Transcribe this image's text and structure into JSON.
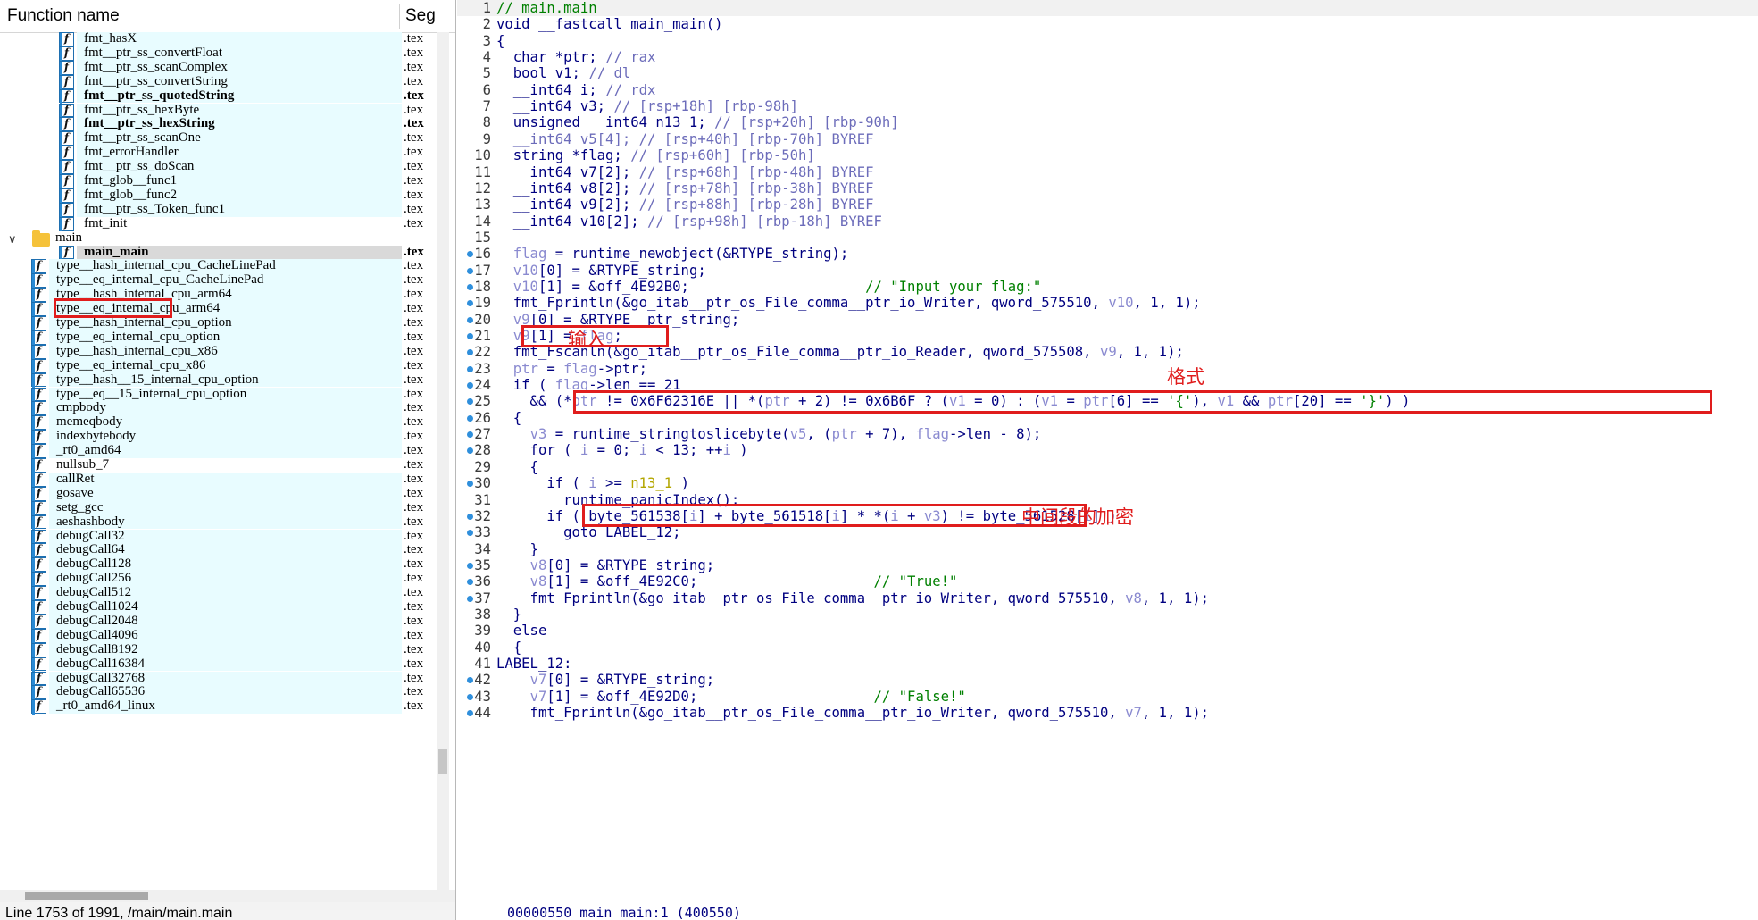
{
  "function_panel": {
    "header_name": "Function name",
    "header_seg": "Seg",
    "status": "Line 1753 of 1991, /main/main.main",
    "rows": [
      {
        "name": "fmt_hasX",
        "seg": ".tex",
        "indent": 2,
        "bold": false,
        "bg": "cyan"
      },
      {
        "name": "fmt__ptr_ss_convertFloat",
        "seg": ".tex",
        "indent": 2,
        "bold": false,
        "bg": "cyan"
      },
      {
        "name": "fmt__ptr_ss_scanComplex",
        "seg": ".tex",
        "indent": 2,
        "bold": false,
        "bg": "cyan"
      },
      {
        "name": "fmt__ptr_ss_convertString",
        "seg": ".tex",
        "indent": 2,
        "bold": false,
        "bg": "cyan"
      },
      {
        "name": "fmt__ptr_ss_quotedString",
        "seg": ".tex",
        "indent": 2,
        "bold": true,
        "bg": "cyan"
      },
      {
        "name": "fmt__ptr_ss_hexByte",
        "seg": ".tex",
        "indent": 2,
        "bold": false,
        "bg": "cyan"
      },
      {
        "name": "fmt__ptr_ss_hexString",
        "seg": ".tex",
        "indent": 2,
        "bold": true,
        "bg": "cyan"
      },
      {
        "name": "fmt__ptr_ss_scanOne",
        "seg": ".tex",
        "indent": 2,
        "bold": false,
        "bg": "cyan"
      },
      {
        "name": "fmt_errorHandler",
        "seg": ".tex",
        "indent": 2,
        "bold": false,
        "bg": "cyan"
      },
      {
        "name": "fmt__ptr_ss_doScan",
        "seg": ".tex",
        "indent": 2,
        "bold": false,
        "bg": "cyan"
      },
      {
        "name": "fmt_glob__func1",
        "seg": ".tex",
        "indent": 2,
        "bold": false,
        "bg": "cyan"
      },
      {
        "name": "fmt_glob__func2",
        "seg": ".tex",
        "indent": 2,
        "bold": false,
        "bg": "cyan"
      },
      {
        "name": "fmt__ptr_ss_Token_func1",
        "seg": ".tex",
        "indent": 2,
        "bold": false,
        "bg": "cyan"
      },
      {
        "name": "fmt_init",
        "seg": ".tex",
        "indent": 2,
        "bold": false,
        "bg": "white"
      },
      {
        "name": "main",
        "seg": "",
        "indent": 0,
        "bold": false,
        "bg": "white",
        "folder": true
      },
      {
        "name": "main_main",
        "seg": ".tex",
        "indent": 2,
        "bold": true,
        "bg": "gray"
      },
      {
        "name": "type__hash_internal_cpu_CacheLinePad",
        "seg": ".tex",
        "indent": 1,
        "bold": false,
        "bg": "cyan"
      },
      {
        "name": "type__eq_internal_cpu_CacheLinePad",
        "seg": ".tex",
        "indent": 1,
        "bold": false,
        "bg": "cyan"
      },
      {
        "name": "type__hash_internal_cpu_arm64",
        "seg": ".tex",
        "indent": 1,
        "bold": false,
        "bg": "cyan"
      },
      {
        "name": "type__eq_internal_cpu_arm64",
        "seg": ".tex",
        "indent": 1,
        "bold": false,
        "bg": "cyan"
      },
      {
        "name": "type__hash_internal_cpu_option",
        "seg": ".tex",
        "indent": 1,
        "bold": false,
        "bg": "cyan"
      },
      {
        "name": "type__eq_internal_cpu_option",
        "seg": ".tex",
        "indent": 1,
        "bold": false,
        "bg": "cyan"
      },
      {
        "name": "type__hash_internal_cpu_x86",
        "seg": ".tex",
        "indent": 1,
        "bold": false,
        "bg": "cyan"
      },
      {
        "name": "type__eq_internal_cpu_x86",
        "seg": ".tex",
        "indent": 1,
        "bold": false,
        "bg": "cyan"
      },
      {
        "name": "type__hash__15_internal_cpu_option",
        "seg": ".tex",
        "indent": 1,
        "bold": false,
        "bg": "cyan"
      },
      {
        "name": "type__eq__15_internal_cpu_option",
        "seg": ".tex",
        "indent": 1,
        "bold": false,
        "bg": "cyan"
      },
      {
        "name": "cmpbody",
        "seg": ".tex",
        "indent": 1,
        "bold": false,
        "bg": "cyan"
      },
      {
        "name": "memeqbody",
        "seg": ".tex",
        "indent": 1,
        "bold": false,
        "bg": "cyan"
      },
      {
        "name": "indexbytebody",
        "seg": ".tex",
        "indent": 1,
        "bold": false,
        "bg": "cyan"
      },
      {
        "name": "_rt0_amd64",
        "seg": ".tex",
        "indent": 1,
        "bold": false,
        "bg": "cyan"
      },
      {
        "name": "nullsub_7",
        "seg": ".tex",
        "indent": 1,
        "bold": false,
        "bg": "white"
      },
      {
        "name": "callRet",
        "seg": ".tex",
        "indent": 1,
        "bold": false,
        "bg": "cyan"
      },
      {
        "name": "gosave",
        "seg": ".tex",
        "indent": 1,
        "bold": false,
        "bg": "cyan"
      },
      {
        "name": "setg_gcc",
        "seg": ".tex",
        "indent": 1,
        "bold": false,
        "bg": "cyan"
      },
      {
        "name": "aeshashbody",
        "seg": ".tex",
        "indent": 1,
        "bold": false,
        "bg": "cyan"
      },
      {
        "name": "debugCall32",
        "seg": ".tex",
        "indent": 1,
        "bold": false,
        "bg": "cyan"
      },
      {
        "name": "debugCall64",
        "seg": ".tex",
        "indent": 1,
        "bold": false,
        "bg": "cyan"
      },
      {
        "name": "debugCall128",
        "seg": ".tex",
        "indent": 1,
        "bold": false,
        "bg": "cyan"
      },
      {
        "name": "debugCall256",
        "seg": ".tex",
        "indent": 1,
        "bold": false,
        "bg": "cyan"
      },
      {
        "name": "debugCall512",
        "seg": ".tex",
        "indent": 1,
        "bold": false,
        "bg": "cyan"
      },
      {
        "name": "debugCall1024",
        "seg": ".tex",
        "indent": 1,
        "bold": false,
        "bg": "cyan"
      },
      {
        "name": "debugCall2048",
        "seg": ".tex",
        "indent": 1,
        "bold": false,
        "bg": "cyan"
      },
      {
        "name": "debugCall4096",
        "seg": ".tex",
        "indent": 1,
        "bold": false,
        "bg": "cyan"
      },
      {
        "name": "debugCall8192",
        "seg": ".tex",
        "indent": 1,
        "bold": false,
        "bg": "cyan"
      },
      {
        "name": "debugCall16384",
        "seg": ".tex",
        "indent": 1,
        "bold": false,
        "bg": "cyan"
      },
      {
        "name": "debugCall32768",
        "seg": ".tex",
        "indent": 1,
        "bold": false,
        "bg": "cyan"
      },
      {
        "name": "debugCall65536",
        "seg": ".tex",
        "indent": 1,
        "bold": false,
        "bg": "cyan"
      },
      {
        "name": "_rt0_amd64_linux",
        "seg": ".tex",
        "indent": 1,
        "bold": false,
        "bg": "cyan"
      }
    ]
  },
  "code_panel": {
    "lines": [
      {
        "n": "1",
        "dot": false,
        "html": "<span class='tok-g'>// main.main</span>"
      },
      {
        "n": "2",
        "dot": false,
        "html": "void __fastcall main_main()"
      },
      {
        "n": "3",
        "dot": false,
        "html": "{"
      },
      {
        "n": "4",
        "dot": false,
        "html": "  char *ptr; <span class='tok-c'>// rax</span>"
      },
      {
        "n": "5",
        "dot": false,
        "html": "  bool v1; <span class='tok-c'>// dl</span>"
      },
      {
        "n": "6",
        "dot": false,
        "html": "  __int64 i; <span class='tok-c'>// rdx</span>"
      },
      {
        "n": "7",
        "dot": false,
        "html": "  __int64 v3; <span class='tok-c'>// [rsp+18h] [rbp-98h]</span>"
      },
      {
        "n": "8",
        "dot": false,
        "html": "  unsigned __int64 n13_1; <span class='tok-c'>// [rsp+20h] [rbp-90h]</span>"
      },
      {
        "n": "9",
        "dot": false,
        "html": "  <span class='tok-c'>__int64 v5[4]; // [rsp+40h] [rbp-70h] BYREF</span>"
      },
      {
        "n": "10",
        "dot": false,
        "html": "  string *flag; <span class='tok-c'>// [rsp+60h] [rbp-50h]</span>"
      },
      {
        "n": "11",
        "dot": false,
        "html": "  __int64 v7[2]; <span class='tok-c'>// [rsp+68h] [rbp-48h] BYREF</span>"
      },
      {
        "n": "12",
        "dot": false,
        "html": "  __int64 v8[2]; <span class='tok-c'>// [rsp+78h] [rbp-38h] BYREF</span>"
      },
      {
        "n": "13",
        "dot": false,
        "html": "  __int64 v9[2]; <span class='tok-c'>// [rsp+88h] [rbp-28h] BYREF</span>"
      },
      {
        "n": "14",
        "dot": false,
        "html": "  __int64 v10[2]; <span class='tok-c'>// [rsp+98h] [rbp-18h] BYREF</span>"
      },
      {
        "n": "15",
        "dot": false,
        "html": ""
      },
      {
        "n": "16",
        "dot": true,
        "html": "  <span class='tok-v'>flag</span> = runtime_newobject(&amp;RTYPE_string);"
      },
      {
        "n": "17",
        "dot": true,
        "html": "  <span class='tok-v'>v10</span>[0] = &amp;RTYPE_string;"
      },
      {
        "n": "18",
        "dot": true,
        "html": "  <span class='tok-v'>v10</span>[1] = &amp;off_4E92B0;                     <span class='tok-g'>// \"Input your flag:\"</span>"
      },
      {
        "n": "19",
        "dot": true,
        "html": "  fmt_Fprintln(&amp;go_itab__ptr_os_File_comma__ptr_io_Writer, qword_575510, <span class='tok-v'>v10</span>, 1, 1);"
      },
      {
        "n": "20",
        "dot": true,
        "html": "  <span class='tok-v'>v9</span>[0] = &amp;RTYPE__ptr_string;"
      },
      {
        "n": "21",
        "dot": true,
        "html": "  <span class='tok-v'>v9</span>[1] = <span class='tok-v'>flag</span>;"
      },
      {
        "n": "22",
        "dot": true,
        "html": "  fmt_Fscanln(&amp;go_itab__ptr_os_File_comma__ptr_io_Reader, qword_575508, <span class='tok-v'>v9</span>, 1, 1);"
      },
      {
        "n": "23",
        "dot": true,
        "html": "  <span class='tok-v'>ptr</span> = <span class='tok-v'>flag</span>-&gt;ptr;"
      },
      {
        "n": "24",
        "dot": true,
        "html": "  if ( <span class='tok-v'>flag</span>-&gt;len == 21"
      },
      {
        "n": "25",
        "dot": true,
        "html": "    &amp;&amp; (*<span class='tok-v'>ptr</span> != 0x6F62316E || *(<span class='tok-v'>ptr</span> + 2) != 0x6B6F ? (<span class='tok-v'>v1</span> = 0) : (<span class='tok-v'>v1</span> = <span class='tok-v'>ptr</span>[6] == <span class='tok-g'>'{'</span>), <span class='tok-v'>v1</span> &amp;&amp; <span class='tok-v'>ptr</span>[20] == <span class='tok-g'>'}'</span>) )"
      },
      {
        "n": "26",
        "dot": true,
        "html": "  {"
      },
      {
        "n": "27",
        "dot": true,
        "html": "    <span class='tok-v'>v3</span> = runtime_stringtoslicebyte(<span class='tok-v'>v5</span>, (<span class='tok-v'>ptr</span> + 7), <span class='tok-v'>flag</span>-&gt;len - 8);"
      },
      {
        "n": "28",
        "dot": true,
        "html": "    for ( <span class='tok-v'>i</span> = 0; <span class='tok-v'>i</span> &lt; 13; ++<span class='tok-v'>i</span> )"
      },
      {
        "n": "29",
        "dot": false,
        "html": "    {"
      },
      {
        "n": "30",
        "dot": true,
        "html": "      if ( <span class='tok-v'>i</span> &gt;= <span class='tok-o'>n13_1</span> )"
      },
      {
        "n": "31",
        "dot": false,
        "html": "        runtime_panicIndex();"
      },
      {
        "n": "32",
        "dot": true,
        "html": "      if ( byte_561538[<span class='tok-v'>i</span>] + byte_561518[<span class='tok-v'>i</span>] * *(<span class='tok-v'>i</span> + <span class='tok-v'>v3</span>) != byte_561528[<span class='tok-v'>i</span>] )"
      },
      {
        "n": "33",
        "dot": true,
        "html": "        goto LABEL_12;"
      },
      {
        "n": "34",
        "dot": false,
        "html": "    }"
      },
      {
        "n": "35",
        "dot": true,
        "html": "    <span class='tok-v'>v8</span>[0] = &amp;RTYPE_string;"
      },
      {
        "n": "36",
        "dot": true,
        "html": "    <span class='tok-v'>v8</span>[1] = &amp;off_4E92C0;                     <span class='tok-g'>// \"True!\"</span>"
      },
      {
        "n": "37",
        "dot": true,
        "html": "    fmt_Fprintln(&amp;go_itab__ptr_os_File_comma__ptr_io_Writer, qword_575510, <span class='tok-v'>v8</span>, 1, 1);"
      },
      {
        "n": "38",
        "dot": false,
        "html": "  }"
      },
      {
        "n": "39",
        "dot": false,
        "html": "  else"
      },
      {
        "n": "40",
        "dot": false,
        "html": "  {"
      },
      {
        "n": "41",
        "dot": false,
        "html": "LABEL_12:"
      },
      {
        "n": "42",
        "dot": true,
        "html": "    <span class='tok-v'>v7</span>[0] = &amp;RTYPE_string;"
      },
      {
        "n": "43",
        "dot": true,
        "html": "    <span class='tok-v'>v7</span>[1] = &amp;off_4E92D0;                     <span class='tok-g'>// \"False!\"</span>"
      },
      {
        "n": "44",
        "dot": true,
        "html": "    fmt_Fprintln(&amp;go_itab__ptr_os_File_comma__ptr_io_Writer, qword_575510, <span class='tok-v'>v7</span>, 1, 1);"
      }
    ],
    "footer": "00000550 main_main:1 (400550)"
  },
  "annotations": {
    "input": "输入",
    "format": "格式",
    "middle_encrypt": "中间段的加密"
  },
  "colors": {
    "annotation_red": "#e01d1d",
    "keyword_navy": "#000080",
    "comment_green": "#008000",
    "variable_lavender": "#8a8ad0"
  }
}
